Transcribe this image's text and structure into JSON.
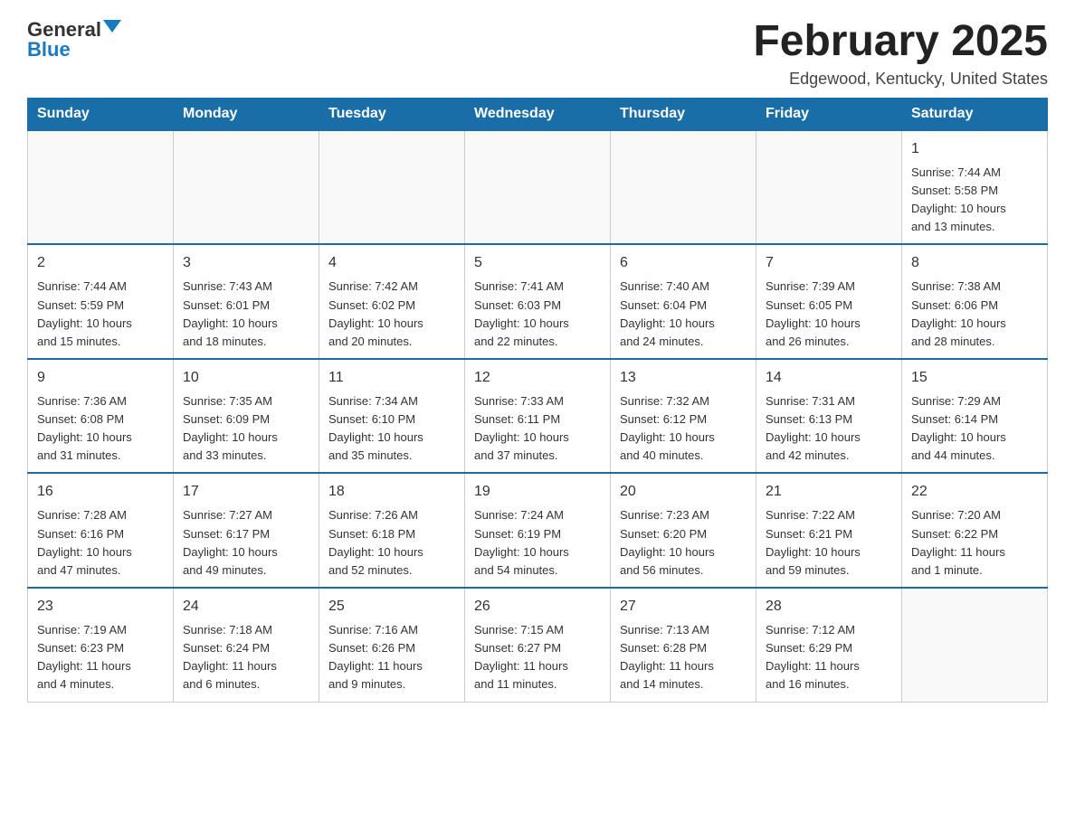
{
  "header": {
    "logo_general": "General",
    "logo_blue": "Blue",
    "title": "February 2025",
    "location": "Edgewood, Kentucky, United States"
  },
  "days_of_week": [
    "Sunday",
    "Monday",
    "Tuesday",
    "Wednesday",
    "Thursday",
    "Friday",
    "Saturday"
  ],
  "weeks": [
    [
      {
        "day": "",
        "info": ""
      },
      {
        "day": "",
        "info": ""
      },
      {
        "day": "",
        "info": ""
      },
      {
        "day": "",
        "info": ""
      },
      {
        "day": "",
        "info": ""
      },
      {
        "day": "",
        "info": ""
      },
      {
        "day": "1",
        "info": "Sunrise: 7:44 AM\nSunset: 5:58 PM\nDaylight: 10 hours\nand 13 minutes."
      }
    ],
    [
      {
        "day": "2",
        "info": "Sunrise: 7:44 AM\nSunset: 5:59 PM\nDaylight: 10 hours\nand 15 minutes."
      },
      {
        "day": "3",
        "info": "Sunrise: 7:43 AM\nSunset: 6:01 PM\nDaylight: 10 hours\nand 18 minutes."
      },
      {
        "day": "4",
        "info": "Sunrise: 7:42 AM\nSunset: 6:02 PM\nDaylight: 10 hours\nand 20 minutes."
      },
      {
        "day": "5",
        "info": "Sunrise: 7:41 AM\nSunset: 6:03 PM\nDaylight: 10 hours\nand 22 minutes."
      },
      {
        "day": "6",
        "info": "Sunrise: 7:40 AM\nSunset: 6:04 PM\nDaylight: 10 hours\nand 24 minutes."
      },
      {
        "day": "7",
        "info": "Sunrise: 7:39 AM\nSunset: 6:05 PM\nDaylight: 10 hours\nand 26 minutes."
      },
      {
        "day": "8",
        "info": "Sunrise: 7:38 AM\nSunset: 6:06 PM\nDaylight: 10 hours\nand 28 minutes."
      }
    ],
    [
      {
        "day": "9",
        "info": "Sunrise: 7:36 AM\nSunset: 6:08 PM\nDaylight: 10 hours\nand 31 minutes."
      },
      {
        "day": "10",
        "info": "Sunrise: 7:35 AM\nSunset: 6:09 PM\nDaylight: 10 hours\nand 33 minutes."
      },
      {
        "day": "11",
        "info": "Sunrise: 7:34 AM\nSunset: 6:10 PM\nDaylight: 10 hours\nand 35 minutes."
      },
      {
        "day": "12",
        "info": "Sunrise: 7:33 AM\nSunset: 6:11 PM\nDaylight: 10 hours\nand 37 minutes."
      },
      {
        "day": "13",
        "info": "Sunrise: 7:32 AM\nSunset: 6:12 PM\nDaylight: 10 hours\nand 40 minutes."
      },
      {
        "day": "14",
        "info": "Sunrise: 7:31 AM\nSunset: 6:13 PM\nDaylight: 10 hours\nand 42 minutes."
      },
      {
        "day": "15",
        "info": "Sunrise: 7:29 AM\nSunset: 6:14 PM\nDaylight: 10 hours\nand 44 minutes."
      }
    ],
    [
      {
        "day": "16",
        "info": "Sunrise: 7:28 AM\nSunset: 6:16 PM\nDaylight: 10 hours\nand 47 minutes."
      },
      {
        "day": "17",
        "info": "Sunrise: 7:27 AM\nSunset: 6:17 PM\nDaylight: 10 hours\nand 49 minutes."
      },
      {
        "day": "18",
        "info": "Sunrise: 7:26 AM\nSunset: 6:18 PM\nDaylight: 10 hours\nand 52 minutes."
      },
      {
        "day": "19",
        "info": "Sunrise: 7:24 AM\nSunset: 6:19 PM\nDaylight: 10 hours\nand 54 minutes."
      },
      {
        "day": "20",
        "info": "Sunrise: 7:23 AM\nSunset: 6:20 PM\nDaylight: 10 hours\nand 56 minutes."
      },
      {
        "day": "21",
        "info": "Sunrise: 7:22 AM\nSunset: 6:21 PM\nDaylight: 10 hours\nand 59 minutes."
      },
      {
        "day": "22",
        "info": "Sunrise: 7:20 AM\nSunset: 6:22 PM\nDaylight: 11 hours\nand 1 minute."
      }
    ],
    [
      {
        "day": "23",
        "info": "Sunrise: 7:19 AM\nSunset: 6:23 PM\nDaylight: 11 hours\nand 4 minutes."
      },
      {
        "day": "24",
        "info": "Sunrise: 7:18 AM\nSunset: 6:24 PM\nDaylight: 11 hours\nand 6 minutes."
      },
      {
        "day": "25",
        "info": "Sunrise: 7:16 AM\nSunset: 6:26 PM\nDaylight: 11 hours\nand 9 minutes."
      },
      {
        "day": "26",
        "info": "Sunrise: 7:15 AM\nSunset: 6:27 PM\nDaylight: 11 hours\nand 11 minutes."
      },
      {
        "day": "27",
        "info": "Sunrise: 7:13 AM\nSunset: 6:28 PM\nDaylight: 11 hours\nand 14 minutes."
      },
      {
        "day": "28",
        "info": "Sunrise: 7:12 AM\nSunset: 6:29 PM\nDaylight: 11 hours\nand 16 minutes."
      },
      {
        "day": "",
        "info": ""
      }
    ]
  ]
}
